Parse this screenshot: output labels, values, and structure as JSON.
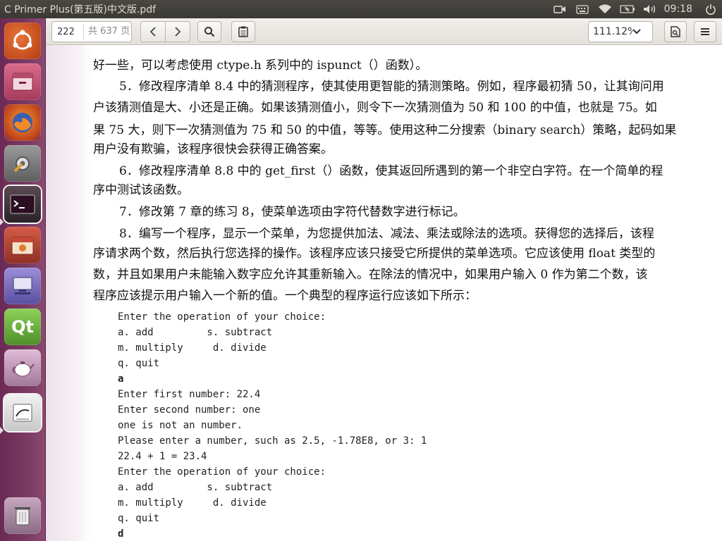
{
  "window": {
    "title": "C Primer Plus(第五版)中文版.pdf",
    "clock": "09:18"
  },
  "indicators": [
    "camera-icon",
    "keyboard-icon",
    "wifi-icon",
    "battery-icon",
    "volume-icon",
    "power-icon"
  ],
  "toolbar": {
    "page_current": "222",
    "page_total": "共 637 页",
    "zoom": "111.12%"
  },
  "launcher": [
    {
      "name": "ubuntu-dash-icon",
      "glyph": "◎",
      "color": "#d9531e"
    },
    {
      "name": "files-icon",
      "glyph": "▭",
      "color": "#c45a7a"
    },
    {
      "name": "firefox-icon",
      "glyph": "◉",
      "color": "#d96a2a"
    },
    {
      "name": "settings-icon",
      "glyph": "✱",
      "color": "#8a8a8a"
    },
    {
      "name": "terminal-icon",
      "glyph": ">_",
      "color": "#3a2e34"
    },
    {
      "name": "calendar-app-icon",
      "glyph": "▦",
      "color": "#b8463a"
    },
    {
      "name": "remote-desktop-icon",
      "glyph": "▭",
      "color": "#7a72c0"
    },
    {
      "name": "qt-creator-icon",
      "glyph": "Qt",
      "color": "#7fbf4a"
    },
    {
      "name": "teapot-icon",
      "glyph": "☕",
      "color": "#c9a0c0"
    },
    {
      "name": "document-viewer-icon",
      "glyph": "✎",
      "color": "#d8d8d8"
    },
    {
      "name": "trash-icon",
      "glyph": "🗑",
      "color": "#b9a0b4"
    }
  ],
  "document": {
    "paragraphs": [
      "好一些，可以考虑使用 ctype.h 系列中的 ispunct（）函数）。",
      "5．修改程序清单 8.4 中的猜测程序，使其使用更智能的猜测策略。例如，程序最初猜 50，让其询问用",
      "户该猜测值是大、小还是正确。如果该猜测值小，则令下一次猜测值为 50 和 100 的中值，也就是 75。如",
      "果 75 大，则下一次猜测值为 75 和 50 的中值，等等。使用这种二分搜索（binary search）策略，起码如果",
      "用户没有欺骗，该程序很快会获得正确答案。",
      "6．修改程序清单 8.8 中的 get_first（）函数，使其返回所遇到的第一个非空白字符。在一个简单的程",
      "序中测试该函数。",
      "7．修改第 7 章的练习 8，使菜单选项由字符代替数字进行标记。",
      "8．编写一个程序，显示一个菜单，为您提供加法、减法、乘法或除法的选项。获得您的选择后，该程",
      "序请求两个数，然后执行您选择的操作。该程序应该只接受它所提供的菜单选项。它应该使用 float 类型的",
      "数，并且如果用户未能输入数字应允许其重新输入。在除法的情况中，如果用户输入 0 作为第二个数，该",
      "程序应该提示用户输入一个新的值。一个典型的程序运行应该如下所示："
    ],
    "code": [
      {
        "text": "Enter the operation of your choice:",
        "bold": false
      },
      {
        "text": "a. add         s. subtract",
        "bold": false
      },
      {
        "text": "m. multiply     d. divide",
        "bold": false
      },
      {
        "text": "q. quit",
        "bold": false
      },
      {
        "text": "a",
        "bold": true
      },
      {
        "text": "Enter first number: 22.4",
        "bold": false
      },
      {
        "text": "Enter second number: one",
        "bold": false
      },
      {
        "text": "one is not an number.",
        "bold": false
      },
      {
        "text": "Please enter a number, such as 2.5, -1.78E8, or 3: 1",
        "bold": false
      },
      {
        "text": "22.4 + 1 = 23.4",
        "bold": false
      },
      {
        "text": "Enter the operation of your choice:",
        "bold": false
      },
      {
        "text": "a. add         s. subtract",
        "bold": false
      },
      {
        "text": "m. multiply     d. divide",
        "bold": false
      },
      {
        "text": "q. quit",
        "bold": false
      },
      {
        "text": "d",
        "bold": true
      }
    ]
  }
}
